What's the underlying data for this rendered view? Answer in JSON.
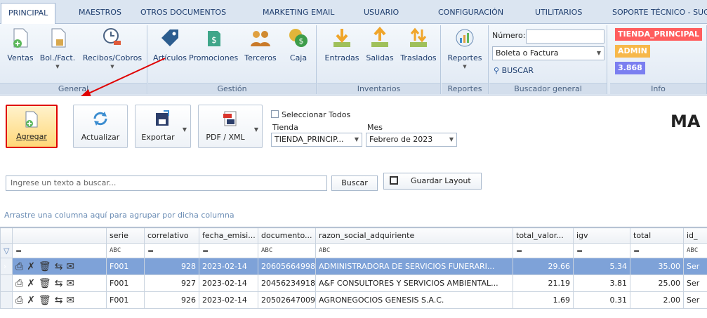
{
  "menu": {
    "tabs": [
      "PRINCIPAL",
      "MAESTROS",
      "OTROS DOCUMENTOS",
      "MARKETING EMAIL",
      "USUARIO",
      "CONFIGURACIÓN",
      "UTILITARIOS",
      "SOPORTE TÉCNICO - SUGE"
    ]
  },
  "ribbon": {
    "general": {
      "caption": "General",
      "buttons": [
        "Ventas",
        "Bol./Fact.",
        "Recibos/Cobros"
      ]
    },
    "gestion": {
      "caption": "Gestión",
      "buttons": [
        "Artículos",
        "Promociones",
        "Terceros",
        "Caja"
      ]
    },
    "inventarios": {
      "caption": "Inventarios",
      "buttons": [
        "Entradas",
        "Salidas",
        "Traslados"
      ]
    },
    "reportes": {
      "caption": "Reportes",
      "buttons": [
        "Reportes"
      ]
    },
    "buscador": {
      "caption": "Buscador general",
      "numero_label": "Número:",
      "doc_type": "Boleta o Factura",
      "buscar": "BUSCAR"
    },
    "info": {
      "caption": "Info",
      "store": "TIENDA_PRINCIPAL",
      "user": "ADMIN",
      "rate": "3.868"
    }
  },
  "toolbar": {
    "agregar": "Agregar",
    "actualizar": "Actualizar",
    "exportar": "Exportar",
    "pdfxml": "PDF / XML",
    "select_all": "Seleccionar Todos",
    "tienda_label": "Tienda",
    "tienda_value": "TIENDA_PRINCIP...",
    "mes_label": "Mes",
    "mes_value": "Febrero de 2023",
    "page_title_partial": "MA"
  },
  "search": {
    "placeholder": "Ingrese un texto a buscar...",
    "buscar": "Buscar",
    "guardar_layout": "Guardar Layout"
  },
  "group_hint": "Arrastre una columna aquí para agrupar por dicha columna",
  "grid": {
    "columns": [
      "serie",
      "correlativo",
      "fecha_emisi...",
      "documento...",
      "razon_social_adquiriente",
      "total_valor...",
      "igv",
      "total",
      "id_"
    ],
    "rows": [
      {
        "serie": "F001",
        "correlativo": "928",
        "fecha": "2023-02-14",
        "documento": "20605664998",
        "razon": "ADMINISTRADORA DE SERVICIOS FUNERARI...",
        "total_valor": "29.66",
        "igv": "5.34",
        "total": "35.00",
        "id": "Ser"
      },
      {
        "serie": "F001",
        "correlativo": "927",
        "fecha": "2023-02-14",
        "documento": "20456234918",
        "razon": "A&F CONSULTORES Y SERVICIOS AMBIENTAL...",
        "total_valor": "21.19",
        "igv": "3.81",
        "total": "25.00",
        "id": "Ser"
      },
      {
        "serie": "F001",
        "correlativo": "926",
        "fecha": "2023-02-14",
        "documento": "20502647009",
        "razon": "AGRONEGOCIOS GENESIS S.A.C.",
        "total_valor": "1.69",
        "igv": "0.31",
        "total": "2.00",
        "id": "Ser"
      }
    ]
  },
  "colors": {
    "accent": "#1f3e6e",
    "selected_row": "#7ea2d8",
    "store_badge": "#ff5d5d",
    "user_badge": "#f7b84a",
    "rate_badge": "#7b7ff0",
    "highlight_border": "#e00000"
  }
}
